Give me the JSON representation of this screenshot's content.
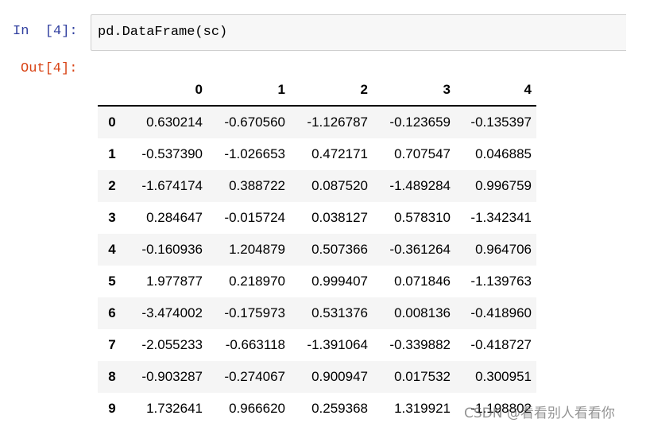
{
  "input_cell": {
    "prompt": "In  [4]:",
    "code": "pd.DataFrame(sc)"
  },
  "output_cell": {
    "prompt": "Out[4]:"
  },
  "dataframe": {
    "columns": [
      "0",
      "1",
      "2",
      "3",
      "4"
    ],
    "rows": [
      {
        "index": "0",
        "values": [
          "0.630214",
          "-0.670560",
          "-1.126787",
          "-0.123659",
          "-0.135397"
        ]
      },
      {
        "index": "1",
        "values": [
          "-0.537390",
          "-1.026653",
          "0.472171",
          "0.707547",
          "0.046885"
        ]
      },
      {
        "index": "2",
        "values": [
          "-1.674174",
          "0.388722",
          "0.087520",
          "-1.489284",
          "0.996759"
        ]
      },
      {
        "index": "3",
        "values": [
          "0.284647",
          "-0.015724",
          "0.038127",
          "0.578310",
          "-1.342341"
        ]
      },
      {
        "index": "4",
        "values": [
          "-0.160936",
          "1.204879",
          "0.507366",
          "-0.361264",
          "0.964706"
        ]
      },
      {
        "index": "5",
        "values": [
          "1.977877",
          "0.218970",
          "0.999407",
          "0.071846",
          "-1.139763"
        ]
      },
      {
        "index": "6",
        "values": [
          "-3.474002",
          "-0.175973",
          "0.531376",
          "0.008136",
          "-0.418960"
        ]
      },
      {
        "index": "7",
        "values": [
          "-2.055233",
          "-0.663118",
          "-1.391064",
          "-0.339882",
          "-0.418727"
        ]
      },
      {
        "index": "8",
        "values": [
          "-0.903287",
          "-0.274067",
          "0.900947",
          "0.017532",
          "0.300951"
        ]
      },
      {
        "index": "9",
        "values": [
          "1.732641",
          "0.966620",
          "0.259368",
          "1.319921",
          "-1.198802"
        ]
      }
    ]
  },
  "watermark": "CSDN @看看别人看看你",
  "colors": {
    "in_prompt": "#303f9f",
    "out_prompt": "#d84315",
    "cell_background": "#f7f7f7",
    "cell_border": "#cfcfcf",
    "row_stripe": "#f5f5f5"
  }
}
